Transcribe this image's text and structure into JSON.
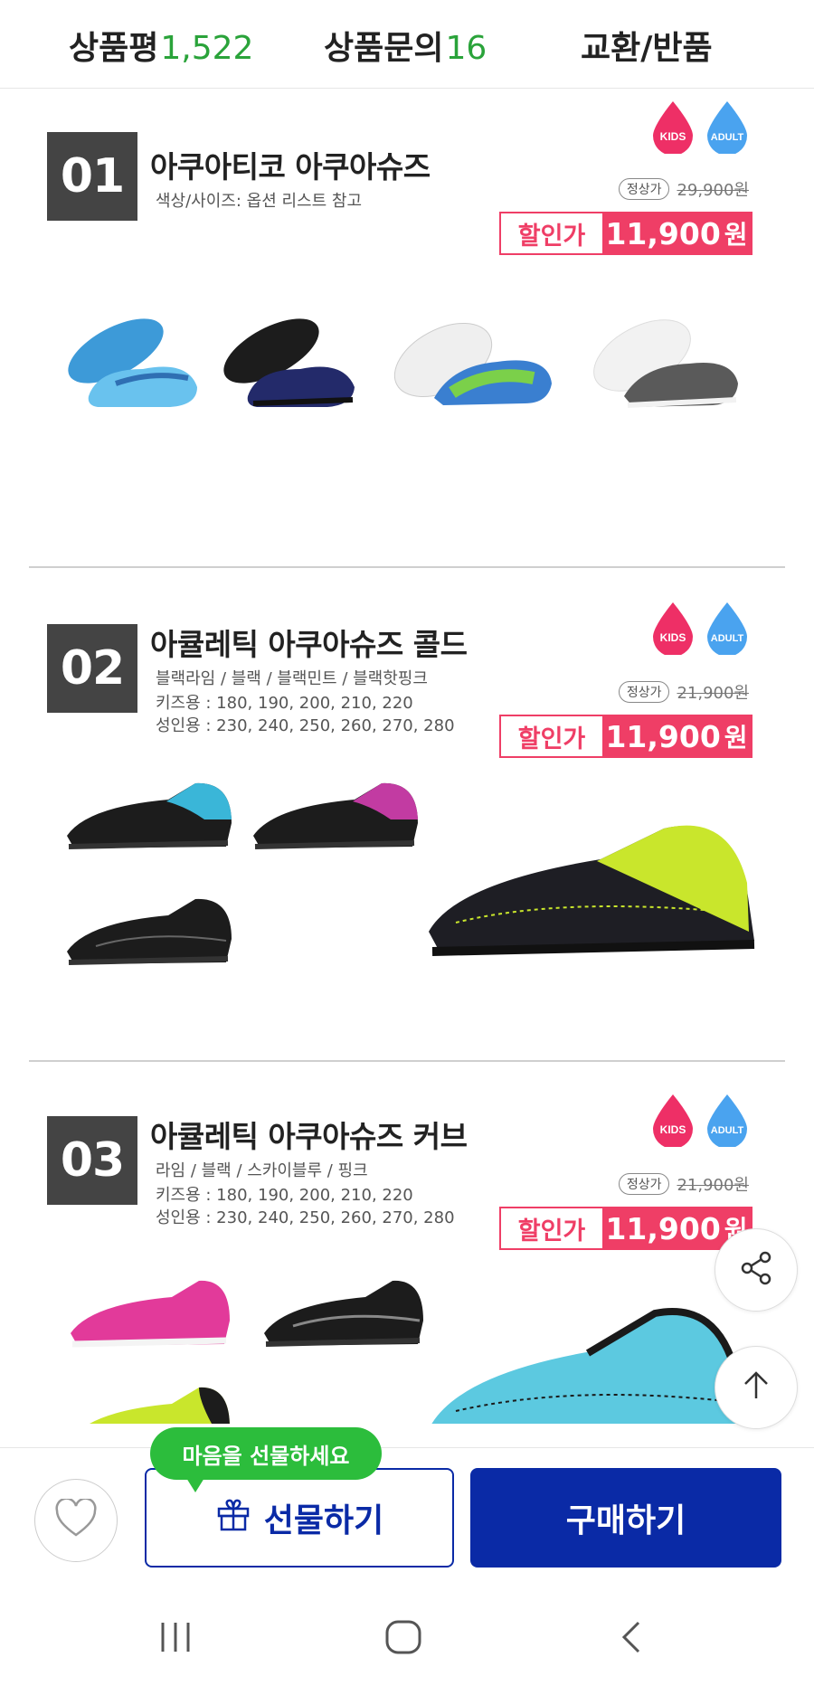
{
  "tabs": {
    "reviews_label": "상품평",
    "reviews_count": "1,522",
    "qna_label": "상품문의",
    "qna_count": "16",
    "exchange_label": "교환/반품"
  },
  "products": [
    {
      "num": "01",
      "name": "아쿠아티코 아쿠아슈즈",
      "desc1": "색상/사이즈: 옵션 리스트 참고",
      "desc2": "",
      "desc3": "",
      "kids": "KIDS",
      "adult": "ADULT",
      "orig_tag": "정상가",
      "orig_price": "29,900원",
      "sale_label": "할인가",
      "sale_price": "11,900",
      "won": "원"
    },
    {
      "num": "02",
      "name": "아큘레틱 아쿠아슈즈 콜드",
      "desc1": "블랙라임 / 블랙 / 블랙민트 / 블랙핫핑크",
      "desc2": "키즈용 : 180, 190, 200, 210, 220",
      "desc3": "성인용 : 230, 240, 250, 260, 270, 280",
      "kids": "KIDS",
      "adult": "ADULT",
      "orig_tag": "정상가",
      "orig_price": "21,900원",
      "sale_label": "할인가",
      "sale_price": "11,900",
      "won": "원"
    },
    {
      "num": "03",
      "name": "아큘레틱 아쿠아슈즈 커브",
      "desc1": "라임 / 블랙 / 스카이블루 / 핑크",
      "desc2": "키즈용 : 180, 190, 200, 210, 220",
      "desc3": "성인용 : 230, 240, 250, 260, 270, 280",
      "kids": "KIDS",
      "adult": "ADULT",
      "orig_tag": "정상가",
      "orig_price": "21,900원",
      "sale_label": "할인가",
      "sale_price": "11,900",
      "won": "원"
    }
  ],
  "actions": {
    "bubble": "마음을 선물하세요",
    "gift": "선물하기",
    "buy": "구매하기"
  },
  "colors": {
    "accent_green": "#2aa33a",
    "sale_pink": "#ef3e66",
    "buy_blue": "#0a2aa6",
    "kids_drop": "#ee2f66",
    "adult_drop": "#4aa3ef"
  },
  "icons": [
    "heart-icon",
    "gift-icon",
    "share-icon",
    "arrow-up-icon",
    "recent-apps-icon",
    "home-icon",
    "back-icon"
  ]
}
